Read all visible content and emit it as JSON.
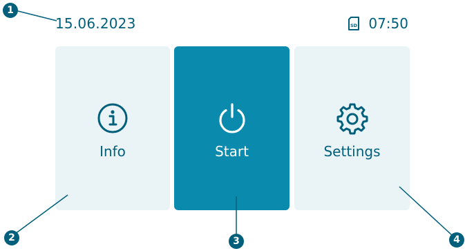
{
  "status_bar": {
    "date": "15.06.2023",
    "time": "07:50",
    "storage_icon": "sd-card-icon"
  },
  "tiles": [
    {
      "label": "Info",
      "icon": "info-icon",
      "state": "normal"
    },
    {
      "label": "Start",
      "icon": "power-icon",
      "state": "selected"
    },
    {
      "label": "Settings",
      "icon": "gear-icon",
      "state": "normal"
    }
  ],
  "callouts": [
    "1",
    "2",
    "3",
    "4"
  ],
  "colors": {
    "accent": "#0a8aac",
    "text": "#005f7a",
    "tile_background": "#eaf4f6",
    "marker": "#005f7a"
  }
}
